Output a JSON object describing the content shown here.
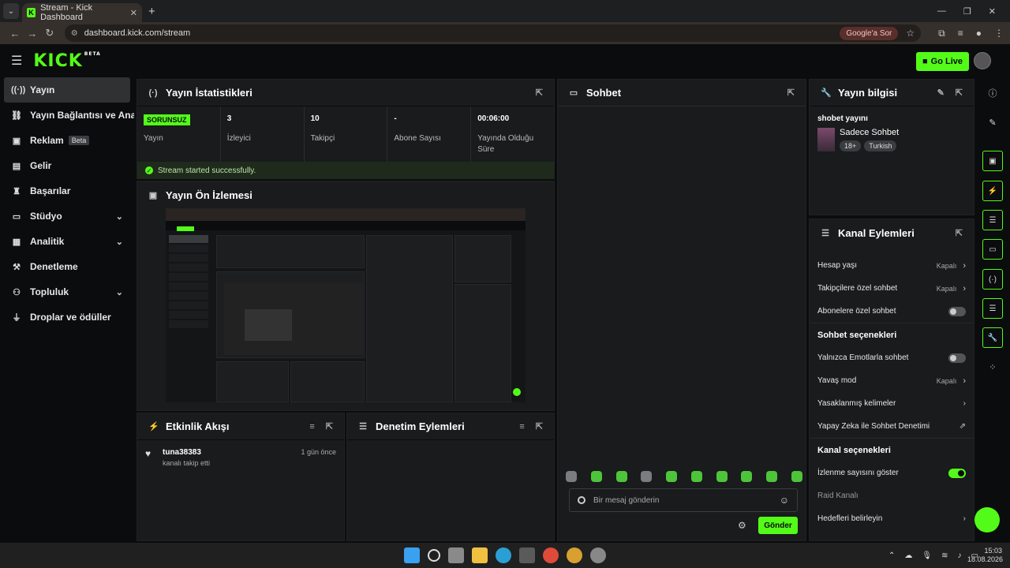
{
  "browser": {
    "tab_title": "Stream - Kick Dashboard",
    "url": "dashboard.kick.com/stream",
    "google_chip": "Google'a Sor",
    "favicon_letter": "K"
  },
  "header": {
    "logo": "KICK",
    "logo_sup": "BETA",
    "go_live": "Go Live"
  },
  "sidebar": {
    "items": [
      {
        "label": "Yayın",
        "icon": "broadcast-icon"
      },
      {
        "label": "Yayın Bağlantısı ve Anahtar",
        "icon": "link-icon"
      },
      {
        "label": "Reklam",
        "icon": "ad-icon",
        "badge": "Beta"
      },
      {
        "label": "Gelir",
        "icon": "revenue-icon"
      },
      {
        "label": "Başarılar",
        "icon": "trophy-icon"
      },
      {
        "label": "Stüdyo",
        "icon": "studio-icon"
      },
      {
        "label": "Analitik",
        "icon": "analytics-icon"
      },
      {
        "label": "Denetleme",
        "icon": "moderation-icon"
      },
      {
        "label": "Topluluk",
        "icon": "community-icon"
      },
      {
        "label": "Droplar ve ödüller",
        "icon": "drops-icon"
      }
    ]
  },
  "stats_panel": {
    "title": "Yayın İstatistikleri",
    "status_badge": "SORUNSUZ",
    "stats": [
      {
        "value": "",
        "label": "Yayın"
      },
      {
        "value": "3",
        "label": "İzleyici"
      },
      {
        "value": "10",
        "label": "Takipçi"
      },
      {
        "value": "-",
        "label": "Abone Sayısı"
      },
      {
        "value": "00:06:00",
        "label": "Yayında Olduğu Süre"
      }
    ],
    "success_message": "Stream started successfully."
  },
  "preview_panel": {
    "title": "Yayın Ön İzlemesi"
  },
  "activity_panel": {
    "title": "Etkinlik Akışı",
    "item": {
      "name": "tuna38383",
      "desc": "kanalı takip etti",
      "time": "1 gün önce"
    }
  },
  "moderation_panel": {
    "title": "Denetim Eylemleri"
  },
  "chat_panel": {
    "title": "Sohbet",
    "placeholder": "Bir mesaj gönderin",
    "send_label": "Gönder"
  },
  "info_panel": {
    "title": "Yayın bilgisi",
    "stream_title": "shobet yayını",
    "category": "Sadece Sohbet",
    "tags": [
      "18+",
      "Turkish"
    ]
  },
  "actions_panel": {
    "title": "Kanal Eylemleri",
    "account_age": {
      "label": "Hesap yaşı",
      "value": "Kapalı"
    },
    "followers_only": {
      "label": "Takipçilere özel sohbet",
      "value": "Kapalı"
    },
    "subs_only": {
      "label": "Abonelere özel sohbet"
    },
    "chat_section": "Sohbet seçenekleri",
    "emote_only": {
      "label": "Yalnızca Emotlarla sohbet"
    },
    "slow_mode": {
      "label": "Yavaş mod",
      "value": "Kapalı"
    },
    "banned_words": {
      "label": "Yasaklanmış kelimeler"
    },
    "ai_mod": {
      "label": "Yapay Zeka ile Sohbet Denetimi"
    },
    "channel_section": "Kanal seçenekleri",
    "show_viewers": {
      "label": "İzlenme sayısını göster"
    },
    "raid": {
      "label": "Raid Kanalı"
    },
    "goals": {
      "label": "Hedefleri belirleyin"
    }
  },
  "taskbar": {
    "time": "15:03",
    "date": "18.08.2026"
  },
  "colors": {
    "accent": "#53fc18",
    "panel": "#191b1c",
    "bg": "#0b0c0d"
  }
}
